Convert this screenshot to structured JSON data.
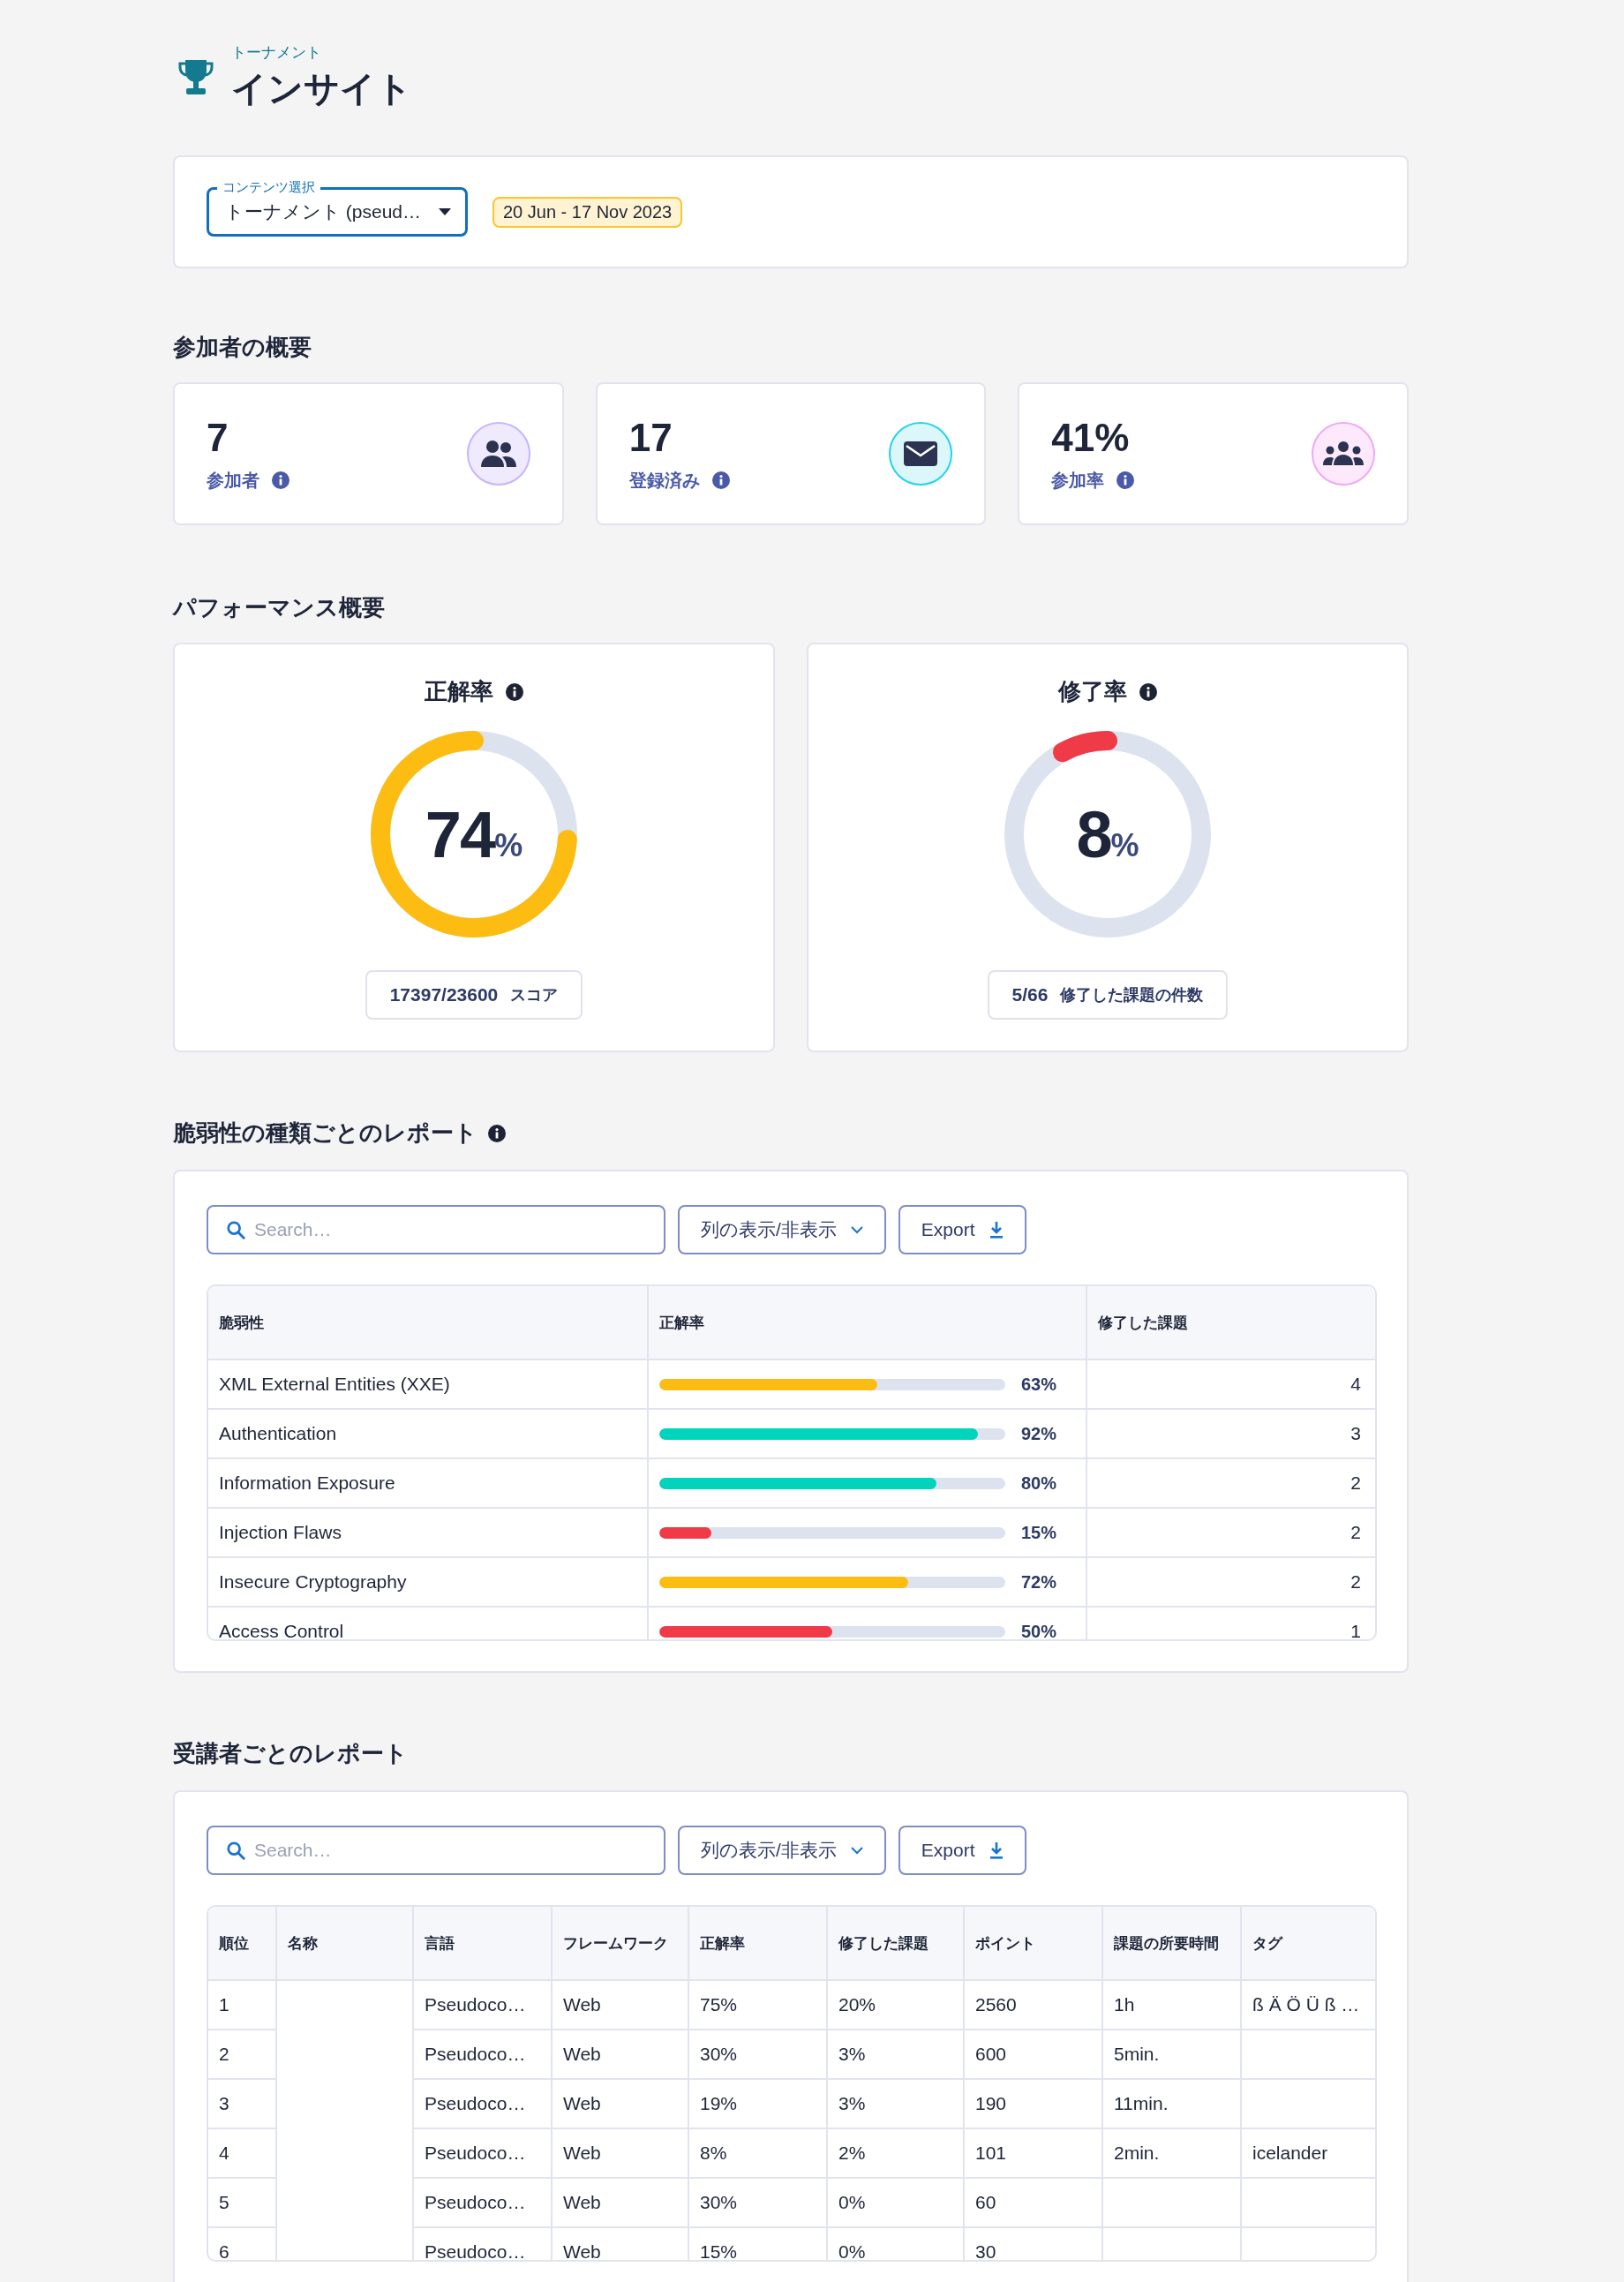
{
  "header": {
    "subtitle": "トーナメント",
    "title": "インサイト"
  },
  "filter": {
    "content_select": {
      "label": "コンテンツ選択",
      "value": "トーナメント (pseud…"
    },
    "date_range": "20 Jun - 17 Nov 2023"
  },
  "participant_overview": {
    "title": "参加者の概要",
    "stats": [
      {
        "kind": "participants",
        "value": "7",
        "label": "参加者"
      },
      {
        "kind": "registered",
        "value": "17",
        "label": "登録済み"
      },
      {
        "kind": "rate",
        "value": "41%",
        "label": "参加率"
      }
    ]
  },
  "performance_overview": {
    "title": "パフォーマンス概要",
    "gauges": [
      {
        "title": "正解率",
        "value": "74",
        "unit": "%",
        "level": 0.74,
        "color": "#fdbc12",
        "summary_value": "17397/23600",
        "summary_label": "スコア"
      },
      {
        "title": "修了率",
        "value": "8",
        "unit": "%",
        "level": 0.08,
        "color": "#ef3a47",
        "summary_value": "5/66",
        "summary_label": "修了した課題の件数"
      }
    ]
  },
  "vulnerability_report": {
    "title": "脆弱性の種類ごとのレポート",
    "search": {
      "placeholder": "Search…"
    },
    "column_toggle": "列の表示/非表示",
    "export": "Export",
    "columns": [
      "脆弱性",
      "正解率",
      "修了した課題"
    ],
    "rows": [
      {
        "name": "XML External Entities (XXE)",
        "level": 0.63,
        "color": "#fdbc12",
        "reading": "63%",
        "completed": "4"
      },
      {
        "name": "Authentication",
        "level": 0.92,
        "color": "#00d4bd",
        "reading": "92%",
        "completed": "3"
      },
      {
        "name": "Information Exposure",
        "level": 0.8,
        "color": "#00d4bd",
        "reading": "80%",
        "completed": "2"
      },
      {
        "name": "Injection Flaws",
        "level": 0.15,
        "color": "#ef3a47",
        "reading": "15%",
        "completed": "2"
      },
      {
        "name": "Insecure Cryptography",
        "level": 0.72,
        "color": "#fdbc12",
        "reading": "72%",
        "completed": "2"
      },
      {
        "name": "Access Control",
        "level": 0.5,
        "color": "#ef3a47",
        "reading": "50%",
        "completed": "1"
      }
    ]
  },
  "learner_report": {
    "title": "受講者ごとのレポート",
    "search": {
      "placeholder": "Search…"
    },
    "column_toggle": "列の表示/非表示",
    "export": "Export",
    "columns": [
      "順位",
      "名称",
      "言語",
      "フレームワーク",
      "正解率",
      "修了した課題",
      "ポイント",
      "課題の所要時間",
      "タグ"
    ],
    "rows": [
      {
        "rank": "1",
        "language": "Pseudoco…",
        "framework": "Web",
        "accuracy": "75%",
        "completed": "20%",
        "points": "2560",
        "time": "1h",
        "tag": "ß Ä Ö Ü ß …"
      },
      {
        "rank": "2",
        "language": "Pseudoco…",
        "framework": "Web",
        "accuracy": "30%",
        "completed": "3%",
        "points": "600",
        "time": "5min."
      },
      {
        "rank": "3",
        "language": "Pseudoco…",
        "framework": "Web",
        "accuracy": "19%",
        "completed": "3%",
        "points": "190",
        "time": "11min."
      },
      {
        "rank": "4",
        "language": "Pseudoco…",
        "framework": "Web",
        "accuracy": "8%",
        "completed": "2%",
        "points": "101",
        "time": "2min.",
        "tag": "icelander"
      },
      {
        "rank": "5",
        "language": "Pseudoco…",
        "framework": "Web",
        "accuracy": "30%",
        "completed": "0%",
        "points": "60"
      },
      {
        "rank": "6",
        "language": "Pseudoco…",
        "framework": "Web",
        "accuracy": "15%",
        "completed": "0%",
        "points": "30"
      }
    ]
  }
}
